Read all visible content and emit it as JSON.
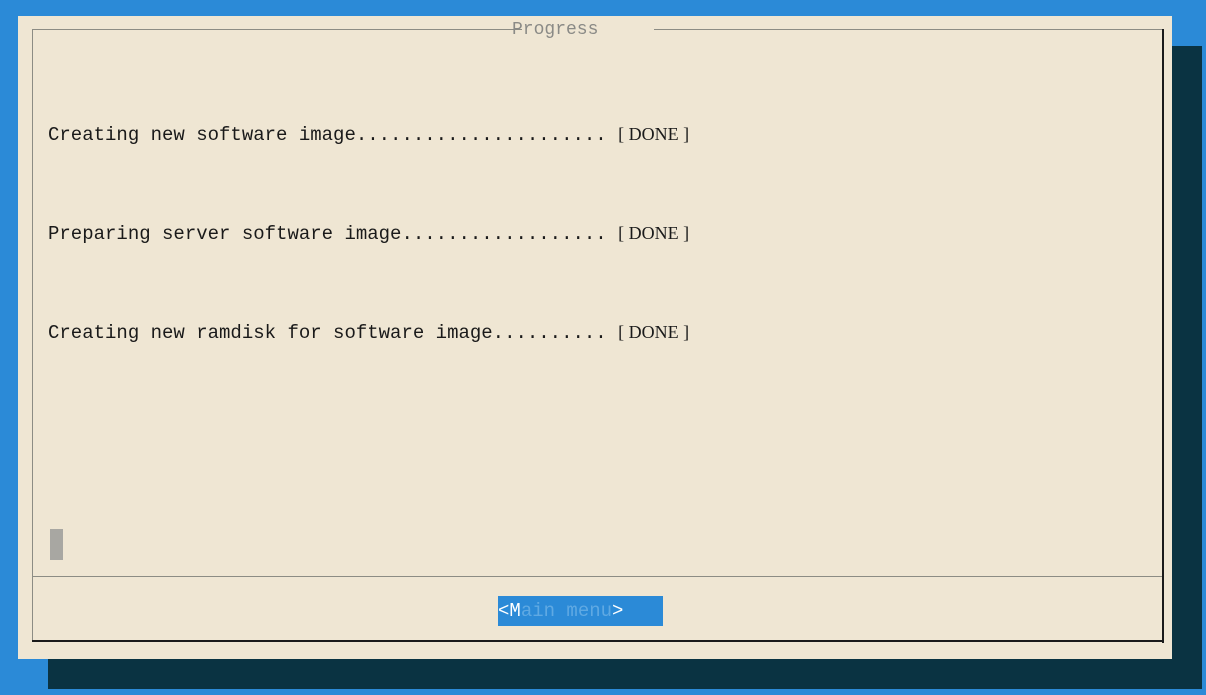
{
  "dialog": {
    "title": "Progress",
    "log": [
      {
        "text": "Creating new software image...................... ",
        "status": "[ DONE ]"
      },
      {
        "text": "Preparing server software image.................. ",
        "status": "[ DONE ]"
      },
      {
        "text": "Creating new ramdisk for software image.......... ",
        "status": "[ DONE ]"
      }
    ],
    "button": {
      "open": "<",
      "hotkey": "M",
      "rest": "ain menu",
      "close": ">"
    }
  },
  "colors": {
    "background": "#2b8ad7",
    "shadow": "#0a3342",
    "dialog": "#efe6d3",
    "button": "#2b8ad7"
  }
}
